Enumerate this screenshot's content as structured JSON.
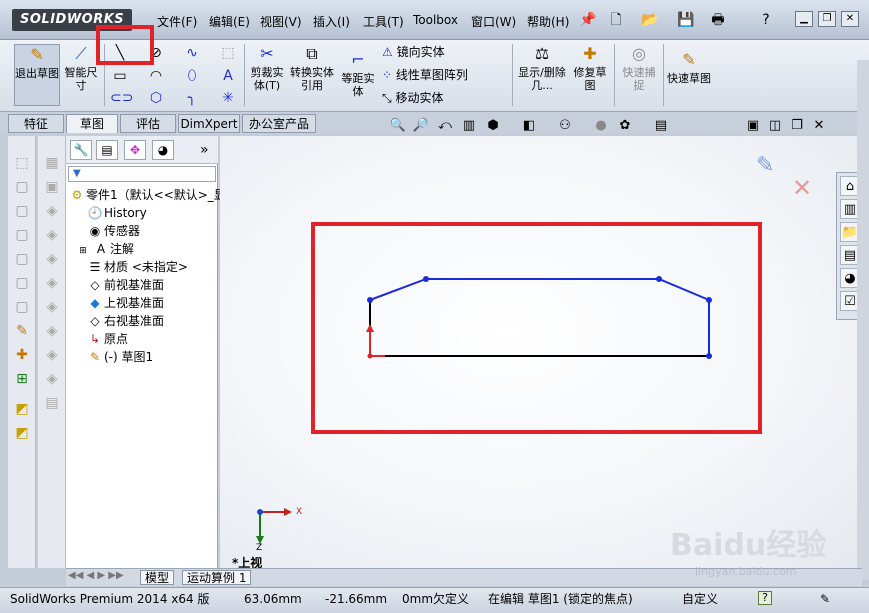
{
  "app": {
    "logo": "SOLIDWORKS"
  },
  "menu": {
    "items": [
      "文件(F)",
      "编辑(E)",
      "视图(V)",
      "插入(I)",
      "工具(T)",
      "Toolbox",
      "窗口(W)",
      "帮助(H)"
    ]
  },
  "ribbon": {
    "exit_sketch": "退出草图",
    "smart_dim": "智能尺寸",
    "trim": "剪裁实体(T)",
    "convert": "转换实体引用",
    "offset": "等距实体",
    "mirror": "镜向实体",
    "linear_pattern": "线性草图阵列",
    "move": "移动实体",
    "show_delete": "显示/删除几...",
    "repair": "修复草图",
    "quick_snap": "快速捕捉",
    "rapid_sketch": "快速草图"
  },
  "cmd_tabs": [
    "特征",
    "草图",
    "评估",
    "DimXpert",
    "办公室产品"
  ],
  "tree": {
    "filter_icon": "filter-icon",
    "root": "零件1（默认<<默认>_显",
    "items": [
      {
        "label": "History",
        "icon": "history-icon"
      },
      {
        "label": "传感器",
        "icon": "sensor-icon"
      },
      {
        "label": "注解",
        "icon": "annotation-icon"
      },
      {
        "label": "材质 <未指定>",
        "icon": "material-icon"
      },
      {
        "label": "前视基准面",
        "icon": "plane-icon"
      },
      {
        "label": "上视基准面",
        "icon": "plane-icon"
      },
      {
        "label": "右视基准面",
        "icon": "plane-icon"
      },
      {
        "label": "原点",
        "icon": "origin-icon"
      },
      {
        "label": "(-) 草图1",
        "icon": "sketch-icon"
      }
    ]
  },
  "view": {
    "label": "*上视",
    "axis_x": "X",
    "axis_z": "Z"
  },
  "bottom_tabs": [
    "模型",
    "运动算例 1"
  ],
  "status": {
    "product": "SolidWorks Premium 2014 x64 版",
    "x": "63.06mm",
    "y": "-21.66mm",
    "z": "0mm",
    "define": "欠定义",
    "editing": "在编辑 草图1 (锁定的焦点)",
    "custom": "自定义"
  },
  "watermark": {
    "text": "Baidu经验",
    "sub": "jingyan.baidu.com"
  },
  "colors": {
    "sketch_line": "#1a2bd9",
    "highlight": "#e02229",
    "origin": "#e02229"
  }
}
